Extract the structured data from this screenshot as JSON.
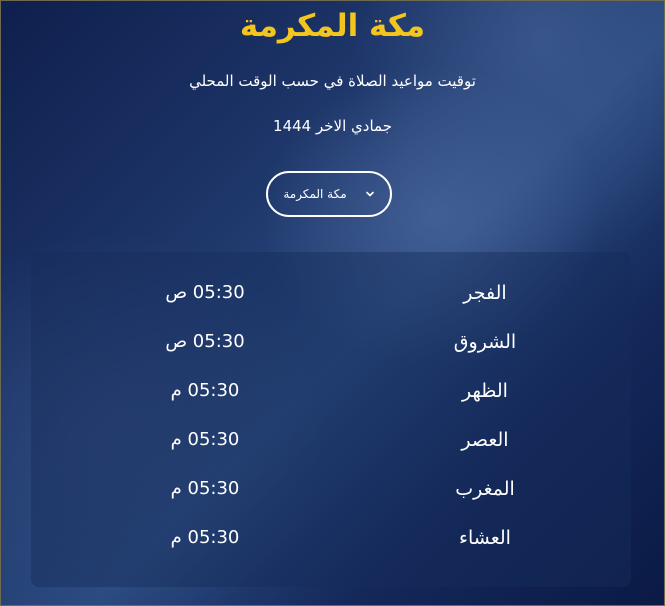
{
  "header": {
    "title": "مكة المكرمة",
    "subtitle": "توقيت مواعيد الصلاة في حسب الوقت المحلي",
    "date": "جمادي الاخر 1444"
  },
  "city_select": {
    "selected": "مكة المكرمة",
    "icon": "chevron-down-icon"
  },
  "prayers": [
    {
      "name": "الفجر",
      "time": "05:30 ص"
    },
    {
      "name": "الشروق",
      "time": "05:30 ص"
    },
    {
      "name": "الظهر",
      "time": "05:30 م"
    },
    {
      "name": "العصر",
      "time": "05:30 م"
    },
    {
      "name": "المغرب",
      "time": "05:30 م"
    },
    {
      "name": "العشاء",
      "time": "05:30 م"
    }
  ],
  "colors": {
    "title": "#f3c51f",
    "text": "#ffffff",
    "background_dark": "#0f1f4d",
    "background_light": "#2a4a80"
  }
}
